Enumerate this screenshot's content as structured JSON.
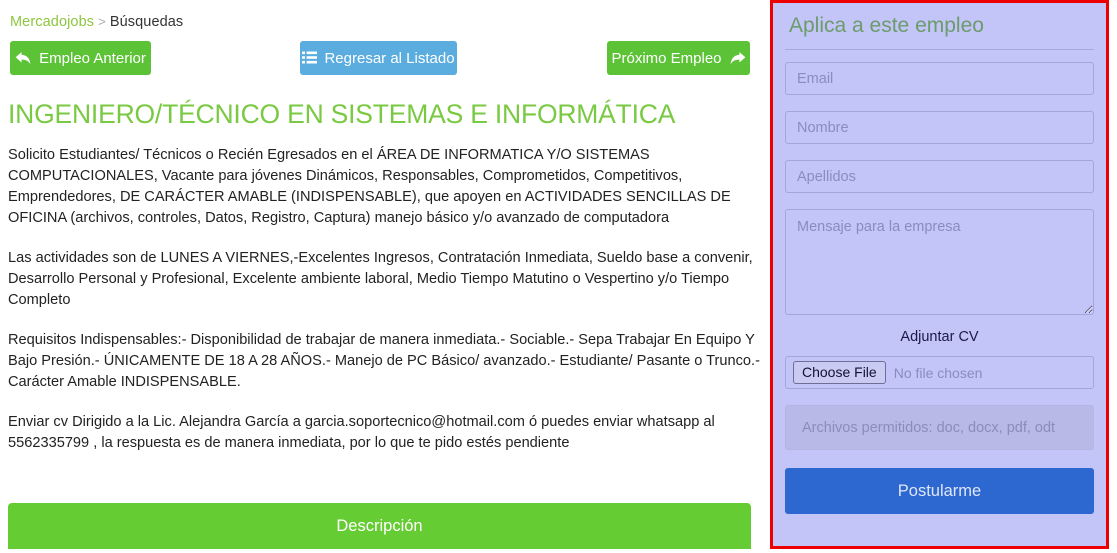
{
  "breadcrumb": {
    "home_label": "Mercadojobs",
    "separator": ">",
    "current_label": "Búsquedas"
  },
  "toolbar": {
    "prev_label": "Empleo Anterior",
    "list_label": "Regresar al Listado",
    "next_label": "Próximo Empleo"
  },
  "job": {
    "title": "INGENIERO/TÉCNICO EN SISTEMAS E INFORMÁTICA",
    "paragraphs": [
      "Solicito Estudiantes/ Técnicos o Recién Egresados en el ÁREA DE INFORMATICA Y/O SISTEMAS COMPUTACIONALES, Vacante para jóvenes Dinámicos, Responsables, Comprometidos, Competitivos, Emprendedores, DE CARÁCTER AMABLE (INDISPENSABLE), que apoyen en ACTIVIDADES SENCILLAS DE OFICINA (archivos, controles, Datos, Registro, Captura) manejo básico y/o avanzado de computadora",
      "Las actividades son de   LUNES A VIERNES,-Excelentes Ingresos, Contratación Inmediata, Sueldo base a convenir, Desarrollo Personal y Profesional, Excelente ambiente laboral, Medio Tiempo Matutino o Vespertino y/o Tiempo Completo",
      "Requisitos Indispensables:- Disponibilidad de trabajar de manera inmediata.- Sociable.- Sepa Trabajar En Equipo Y Bajo Presión.- ÚNICAMENTE DE 18 A 28 AÑOS.- Manejo de PC Básico/ avanzado.- Estudiante/ Pasante o Trunco.- Carácter Amable INDISPENSABLE.",
      "Enviar cv Dirigido a la Lic.   Alejandra García a garcia.soportecnico@hotmail.com ó puedes enviar whatsapp al 5562335799 , la respuesta es de manera inmediata, por lo que te pido estés pendiente"
    ],
    "description_tab_label": "Descripción"
  },
  "apply_form": {
    "heading": "Aplica a este empleo",
    "email_placeholder": "Email",
    "email_value": "",
    "nombre_placeholder": "Nombre",
    "nombre_value": "",
    "apellidos_placeholder": "Apellidos",
    "apellidos_value": "",
    "mensaje_placeholder": "Mensaje para la empresa",
    "mensaje_value": "",
    "attach_label": "Adjuntar CV",
    "choose_file_label": "Choose File",
    "file_status": "No file chosen",
    "allowed_files_hint": "Archivos permitidos: doc, docx, pdf, odt",
    "submit_label": "Postularme"
  },
  "colors": {
    "green": "#5cc236",
    "blue": "#5bade0",
    "title_green": "#7ac943",
    "panel_bg": "#c3c4f7",
    "panel_border": "#ee0000",
    "submit_blue": "#2d68d0",
    "desc_bar_green": "#66cc33"
  }
}
